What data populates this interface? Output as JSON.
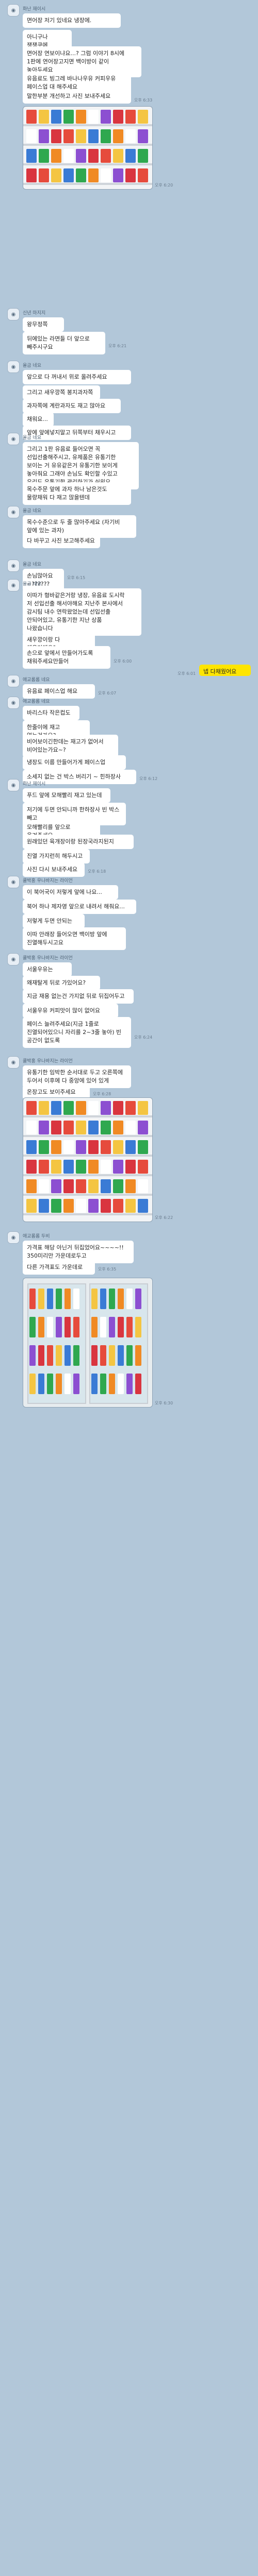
{
  "chat": {
    "messages": [
      {
        "id": "g1",
        "sender": "화난 재이시",
        "avatar": "◉",
        "lines": [
          "면어장 저기 있네요 냉장에.",
          "아니구나 쟁쟁쿠에",
          "면어장 연보이냐요...? 그럼 이야기 8시에\n1판에 연어장고지면 백이방이 같이\n놓아두세요",
          "유음료도 빙그레 바나나우유 커피우유\n페이스업 대 해주세요",
          "말한부분 개선하고 사진 보내주세요"
        ],
        "times": [
          "오후 6:33"
        ]
      },
      {
        "id": "g2",
        "sender": "신년 마지지",
        "avatar": "◉",
        "lines": [
          "왕무정쪽",
          "뒤에있는 라면들 더 앞으로\n빼주시구요"
        ],
        "times": [
          "오후 6:21"
        ]
      },
      {
        "id": "g3",
        "sender": "올금 네요",
        "avatar": "◉",
        "lines": [
          "앞으로 다 꺼내서 위로 올려주세요",
          "그리고 새우깡쪽 봉지과자쪽",
          "과자쪽에 계란과자도 재고 많아요",
          "채워요...",
          "앞에 앞에넣지말고 뒤쪽부터 채우시고"
        ]
      },
      {
        "id": "g4",
        "sender": "올금 네요",
        "avatar": "◉",
        "lines": [
          "그리고 1판 유음료 들어오면 꼭\n선입선출해주시고, 유제품은 유통기한\n보이는 거 유유같은거 유통기한 보이게\n놓아줘요 그래야 손님도 확인할 수있고\n우리도 유통기한 관리하기가 쉬워요",
          "목수주문 앞에 과자 하나 남은것도\n물량채워 다 재고 많을텐데"
        ]
      },
      {
        "id": "g5",
        "sender": "올금 네요",
        "avatar": "◉",
        "lines": [
          "목수수준으로 두 줄 많아주세요 (자기비\n앞에 있는 과자)",
          "다 바꾸고 사진 보고해주세요"
        ]
      },
      {
        "id": "g6",
        "sender": "올금 네요",
        "avatar": "◉",
        "lines": [
          "손님많아요~??????"
        ],
        "times": [
          "오후 6:15"
        ]
      },
      {
        "id": "g7",
        "sender": "올금 네요",
        "avatar": "◉",
        "lines": [
          "이따가 형바같은거랑 냉장, 유음료 도시락\n저 선입선출 해서야해요 지난주 본사에서\n감시팀 내수 연락왔었는데 선입선출\n안되어있고, 유통기한 지난 상품\n나왔습니다",
          "새우깡이랑 다 채운거예요?",
          "손으로 앞에서 만들어가도록\n채워주세요만들어"
        ],
        "times": [
          "오후 6:00"
        ]
      },
      {
        "id": "me1",
        "text": "넵 다채웠어요",
        "time": "오후 6:01"
      },
      {
        "id": "g8",
        "sender": "애교롬롬 네요",
        "avatar": "◉",
        "lines": [
          "유음료 페이스업 해요"
        ],
        "times": [
          "오후 6:07"
        ]
      },
      {
        "id": "g9",
        "sender": "애교롬롬 네요",
        "avatar": "◉",
        "lines": [
          "바리스타 작은컵도",
          "한줄이에 재고 없는건가요?",
          "비어보이긴한데는 재고가 없어서\n비어있는가요~?",
          "냉장도 이름 만들어가게 페이스업",
          "소세지 없는 건 박스 버리기 ~ 힌하장사"
        ],
        "times": [
          "오후 6:12"
        ]
      },
      {
        "id": "g10",
        "sender": "화난 재이시",
        "avatar": "◉",
        "lines": [
          "푸드 앞에 모해빨리 재고 있는데",
          "저기에 두면 안되니까 한하장사 빈 박스\n빼고",
          "모해빨리를 앞으로 옮겨주세요",
          "원래있던 육개장이랑 된장국라지된지",
          "진열 가지런히 해두시고",
          "사진 다시 보내주세요"
        ],
        "times": [
          "오후 6:18"
        ]
      },
      {
        "id": "g11",
        "sender": "쿨박홍 우나바지는 라이언",
        "avatar": "◉",
        "lines": [
          "이 북어국이 저렇게 앞에 나요...",
          "북어 하나 제자영 앞으로 내려서 해줘요...",
          "저렇게 두면 안되는",
          "이따 안래장 들어오면 백이방 앞에\n진열해두시고요"
        ]
      },
      {
        "id": "g12",
        "sender": "쿨박홍 우나바지는 라이언",
        "avatar": "◉",
        "lines": [
          "서울우유는",
          "왜재탈게 뒤로 가있어요?",
          "지금 재용 없는건 가지없 뒤로 뒤집어두고",
          "서울우유 커피맛이 많이 없어요",
          "페이스 늘려주세요(지금 1줄로\n진열되어있으니 자리를 2~3줄 놓아) 빈\n공간이 없도록"
        ],
        "times": [
          "오후 6:24"
        ]
      },
      {
        "id": "g13",
        "sender": "쿨박홍 우나바지는 라이언",
        "avatar": "◉",
        "lines": [
          "유통기한 임박한 순서대로 두고 오른쪽에\n두어서 이후에 다 중앙에 있어 있게",
          "온장고도 보이주세요"
        ],
        "times": [
          "오후 6:28"
        ]
      },
      {
        "id": "g14",
        "sender": "애교롬롬 두비",
        "avatar": "◉",
        "lines": [
          "가격표 해당 아닌거 뒤집었어요~~~~!!\n350미리만 가운데로두고",
          "다른 가격표도 가운데로"
        ],
        "times": [
          "오후 6:35"
        ]
      }
    ],
    "photos": [
      {
        "id": "p1",
        "time": "오후 6:20",
        "desc": "snack-shelf"
      },
      {
        "id": "p2",
        "time": "오후 6:22",
        "desc": "ramen-shelf"
      },
      {
        "id": "p3",
        "time": "오후 6:30",
        "desc": "drink-cooler"
      }
    ]
  }
}
